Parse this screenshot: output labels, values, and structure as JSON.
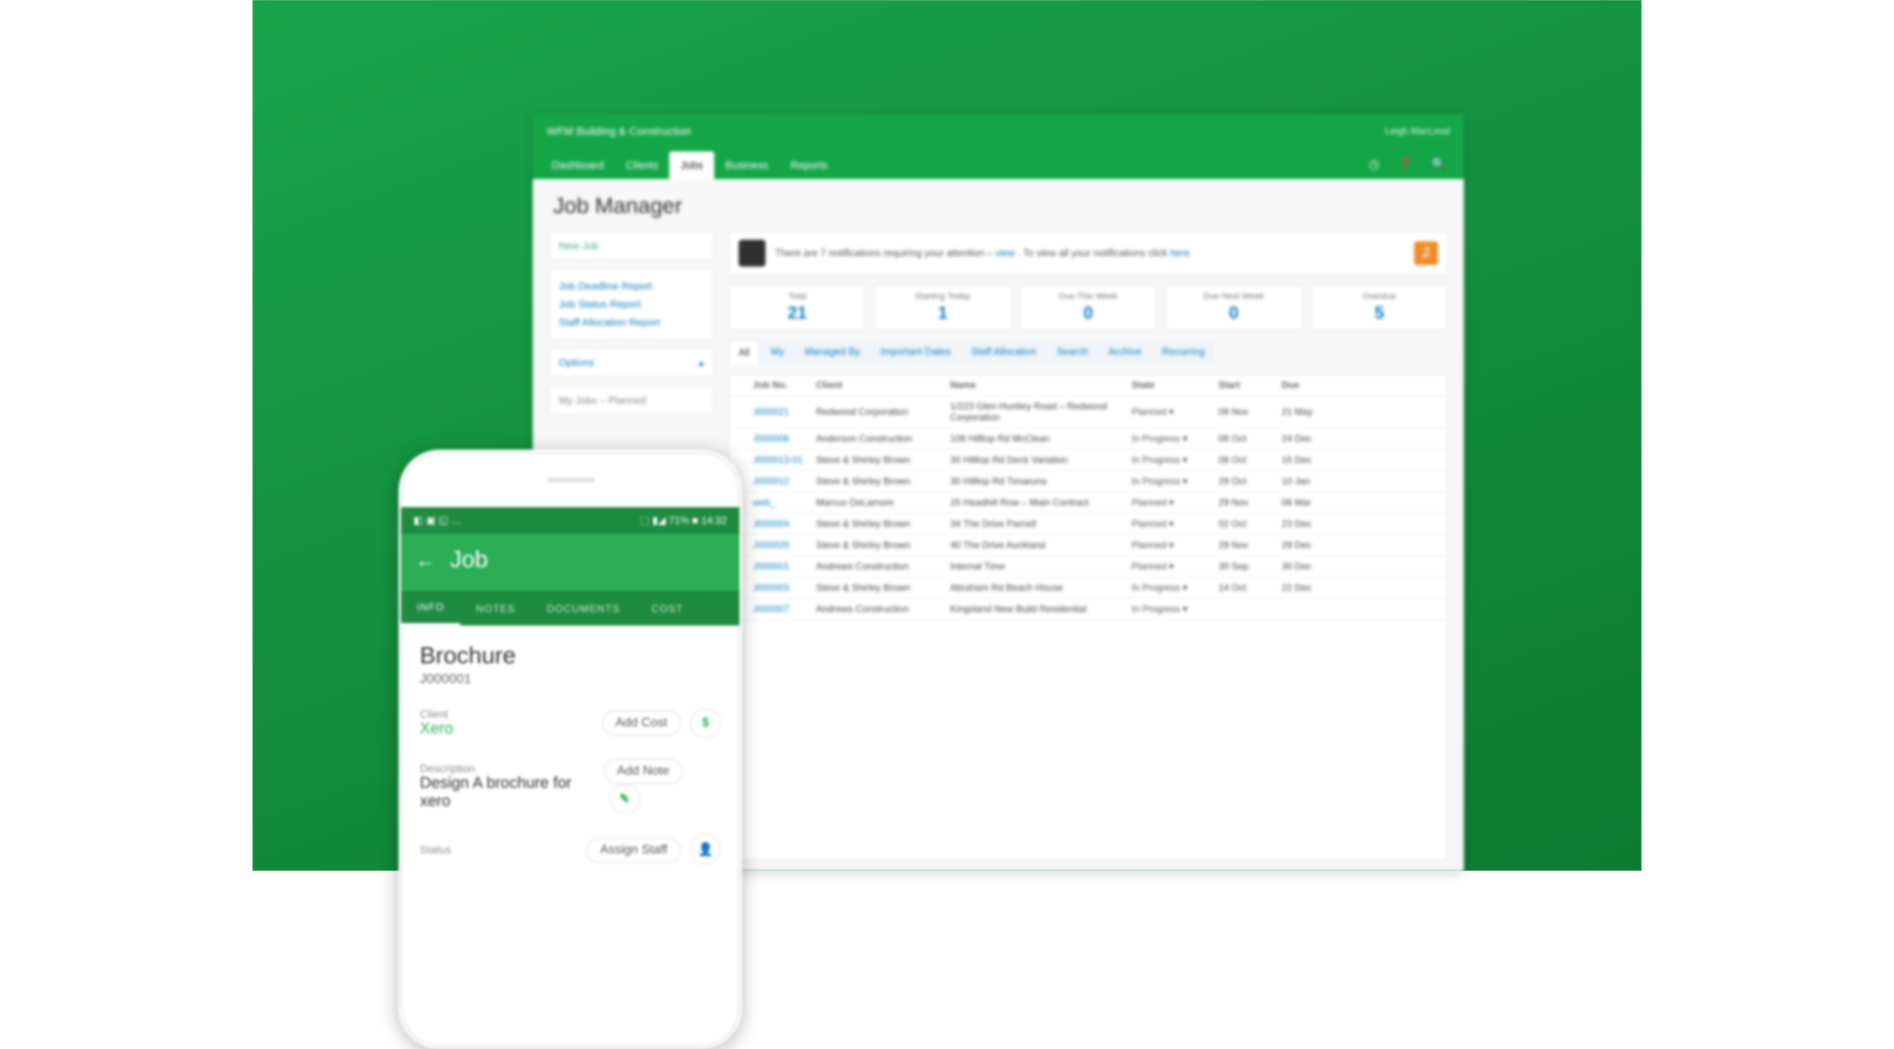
{
  "window": {
    "app_title": "WFM Building & Construction",
    "user_label": "Leigh MacLeod",
    "nav": [
      "Dashboard",
      "Clients",
      "Jobs",
      "Business",
      "Reports"
    ],
    "active_nav_index": 2,
    "page_title": "Job Manager",
    "sidebar": {
      "new_job": "New Job",
      "links": [
        "Job Deadline Report",
        "Job Status Report",
        "Staff Allocation Report"
      ],
      "options_label": "Options",
      "option_item": "My Jobs – Planned"
    },
    "notification": {
      "text_pre": "There are 7 notifications requiring your attention – ",
      "link1": "view",
      "text_mid": ". To view all your notifications click ",
      "link2": "here"
    },
    "stats": [
      {
        "label": "Total",
        "value": "21"
      },
      {
        "label": "Starting Today",
        "value": "1"
      },
      {
        "label": "Due This Week",
        "value": "0"
      },
      {
        "label": "Due Next Week",
        "value": "0"
      },
      {
        "label": "Overdue",
        "value": "5"
      }
    ],
    "subtabs": [
      "All",
      "My",
      "Managed By",
      "Important Dates",
      "Staff Allocation",
      "Search",
      "Archive",
      "Recurring"
    ],
    "active_subtab_index": 0,
    "columns": [
      "",
      "Job No.",
      "Client",
      "Name",
      "State",
      "Start",
      "Due"
    ],
    "rows": [
      {
        "job": "J000021",
        "client": "Redwood Corporation",
        "name": "1/223 Glen Huntley Road – Redwood Corporation",
        "state": "Planned",
        "start": "09 Nov",
        "due": "21 May"
      },
      {
        "job": "J000006",
        "client": "Anderson Construction",
        "name": "106 Hilltop Rd McClean",
        "state": "In Progress",
        "start": "08 Oct",
        "due": "24 Dec"
      },
      {
        "job": "J000013-01",
        "client": "Steve & Shirley Brown",
        "name": "30 Hilltop Rd Deck Variation",
        "state": "In Progress",
        "start": "08 Oct",
        "due": "15 Dec"
      },
      {
        "job": "J000012",
        "client": "Steve & Shirley Brown",
        "name": "30 Hilltop Rd Timaruna",
        "state": "In Progress",
        "start": "29 Oct",
        "due": "10 Jan"
      },
      {
        "job": "web_",
        "client": "Marcus DeLamore",
        "name": "25 Headhill Row – Main Contract",
        "state": "Planned",
        "start": "29 Nov",
        "due": "08 Mar"
      },
      {
        "job": "J000004",
        "client": "Steve & Shirley Brown",
        "name": "34 The Drive Parnell",
        "state": "Planned",
        "start": "02 Oct",
        "due": "23 Dec"
      },
      {
        "job": "J000020",
        "client": "Steve & Shirley Brown",
        "name": "40 The Drive Auckland",
        "state": "Planned",
        "start": "29 Nov",
        "due": "29 Dec"
      },
      {
        "job": "J000001",
        "client": "Andrews Construction",
        "name": "Internal Time",
        "state": "Planned",
        "start": "30 Sep",
        "due": "30 Dec"
      },
      {
        "job": "J000003",
        "client": "Steve & Shirley Brown",
        "name": "Abraham Rd Beach House",
        "state": "In Progress",
        "start": "14 Oct",
        "due": "22 Dec"
      },
      {
        "job": "J000007",
        "client": "Andrews Construction",
        "name": "Kingsland New Build Residential",
        "state": "In Progress",
        "start": "",
        "due": ""
      }
    ]
  },
  "phone": {
    "status": {
      "left_icons": "◧ ▣ ◱ …",
      "signal": "⬚ ▮◢ 71% ■ 14:32"
    },
    "back_icon": "←",
    "screen_title": "Job",
    "tabs": [
      "INFO",
      "NOTES",
      "DOCUMENTS",
      "COST"
    ],
    "active_tab_index": 0,
    "job_title": "Brochure",
    "job_number": "J000001",
    "client_label": "Client",
    "client_value": "Xero",
    "desc_label": "Description",
    "desc_value": "Design A brochure for xero",
    "status_label": "Status",
    "actions": {
      "add_cost": "Add Cost",
      "add_cost_icon": "$",
      "add_note": "Add Note",
      "add_note_icon": "✎",
      "assign_staff": "Assign Staff",
      "assign_staff_icon": "👤"
    }
  },
  "colors": {
    "brand_green": "#14a647",
    "accent_blue": "#0e7fc1",
    "rss_orange": "#f08a24"
  }
}
